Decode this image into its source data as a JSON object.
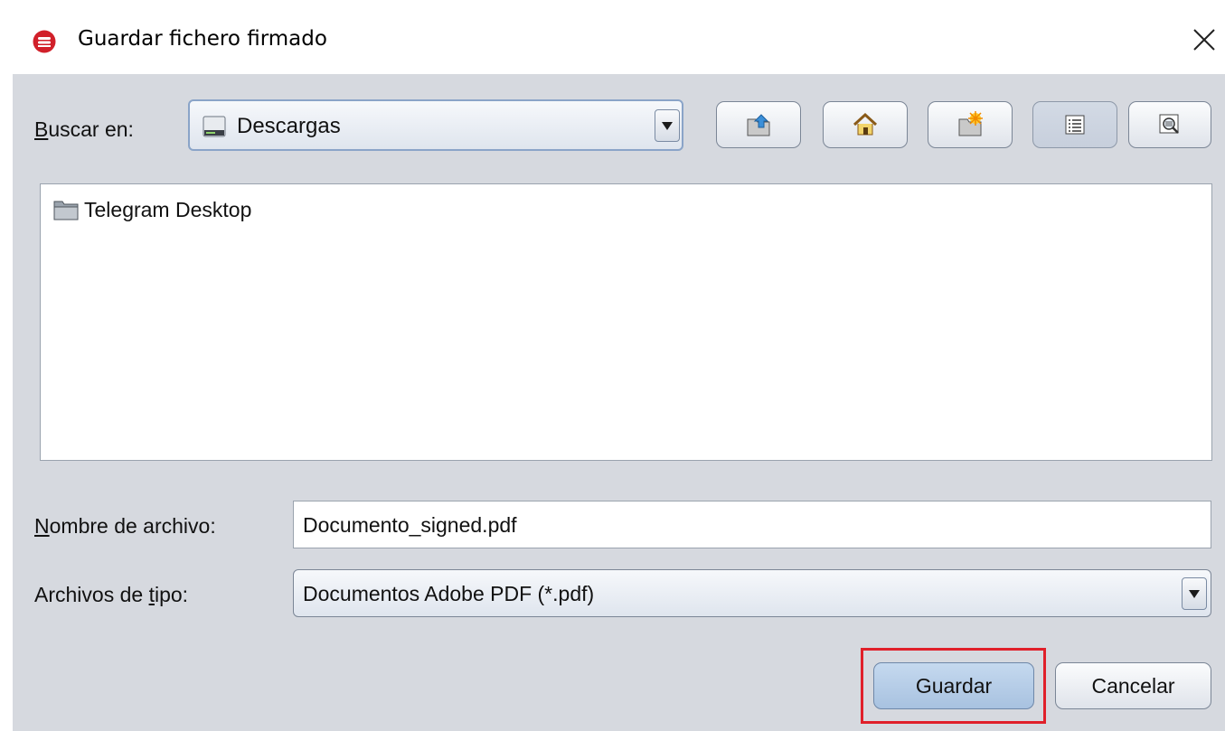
{
  "window": {
    "title": "Guardar fichero firmado",
    "app_icon": "autofirma-logo-icon",
    "close_icon": "close-icon"
  },
  "toolbar": {
    "look_in_label_mnemonic": "B",
    "look_in_label_rest": "uscar en:",
    "look_in_value": "Descargas",
    "look_in_icon": "drive-icon",
    "buttons": [
      {
        "name": "up-folder-button",
        "icon": "up-folder-icon"
      },
      {
        "name": "home-button",
        "icon": "home-icon"
      },
      {
        "name": "new-folder-button",
        "icon": "new-folder-icon"
      },
      {
        "name": "list-view-button",
        "icon": "list-view-icon",
        "active": true
      },
      {
        "name": "details-view-button",
        "icon": "details-view-icon"
      }
    ]
  },
  "file_list": {
    "items": [
      {
        "name": "Telegram Desktop",
        "icon": "folder-icon"
      }
    ]
  },
  "form": {
    "filename_label_mnemonic": "N",
    "filename_label_rest": "ombre de archivo:",
    "filename_value": "Documento_signed.pdf",
    "filetype_label_pre": "Archivos de ",
    "filetype_label_mnemonic": "t",
    "filetype_label_post": "ipo:",
    "filetype_value": "Documentos Adobe PDF (*.pdf)"
  },
  "actions": {
    "save_label": "Guardar",
    "cancel_label": "Cancelar"
  },
  "colors": {
    "dialog_background": "#d6d9df",
    "highlight_border": "#e0202a",
    "app_logo": "#d1202a",
    "default_button": "#b7cde6"
  }
}
